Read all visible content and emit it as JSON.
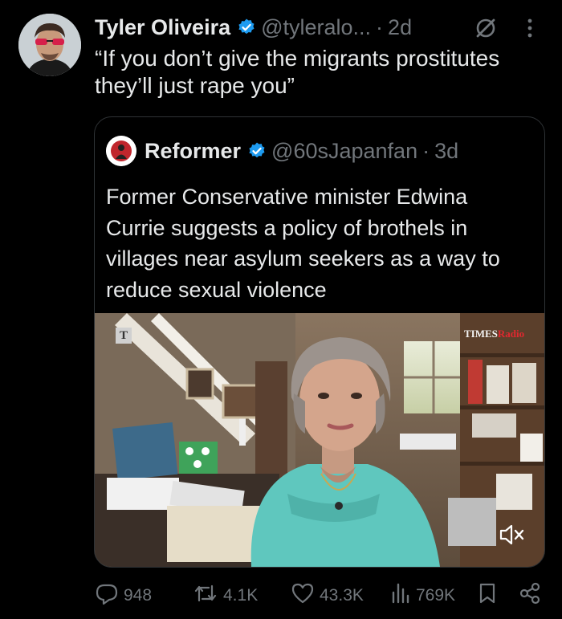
{
  "tweet": {
    "author_name": "Tyler Oliveira",
    "author_handle": "@tyleralo...",
    "separator": "·",
    "time": "2d",
    "text": "“If you don’t give the migrants prostitutes they’ll just rape you”"
  },
  "quoted": {
    "author_name": "Reformer",
    "author_handle": "@60sJapanfan",
    "separator": "·",
    "time": "3d",
    "text": "Former Conservative minister Edwina Currie suggests a policy of brothels in villages near asylum seekers as a way to reduce sexual violence",
    "media": {
      "watermark_left": "T",
      "watermark_right_a": "TIMES",
      "watermark_right_b": "Radio"
    }
  },
  "actions": {
    "replies": "948",
    "reposts": "4.1K",
    "likes": "43.3K",
    "views": "769K"
  },
  "colors": {
    "background": "#000000",
    "text": "#e7e9ea",
    "secondary": "#71767b",
    "verified": "#1d9bf0",
    "border": "#2f3336"
  },
  "icons": [
    "verified-badge-icon",
    "grok-icon",
    "more-icon",
    "reply-icon",
    "repost-icon",
    "like-icon",
    "views-icon",
    "bookmark-icon",
    "share-icon",
    "mute-icon"
  ]
}
